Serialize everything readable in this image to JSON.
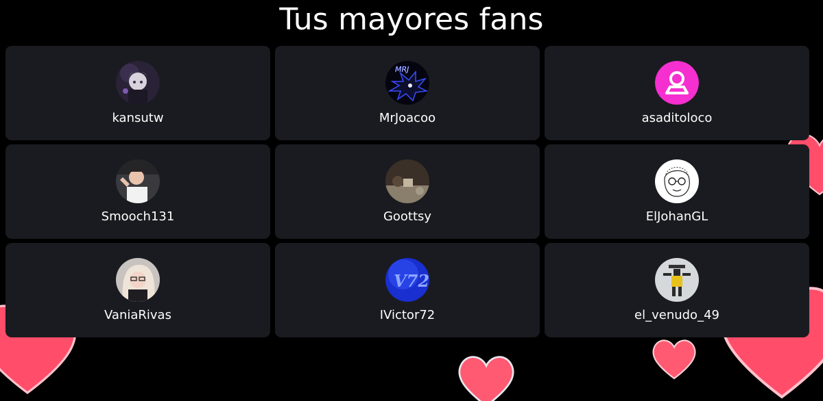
{
  "page": {
    "title": "Tus mayores fans"
  },
  "fans": [
    {
      "username": "kansutw",
      "avatar_icon": "anime-character-avatar-icon"
    },
    {
      "username": "MrJoacoo",
      "avatar_icon": "dark-hedgehog-avatar-icon"
    },
    {
      "username": "asaditoloco",
      "avatar_icon": "default-user-avatar-icon"
    },
    {
      "username": "Smooch131",
      "avatar_icon": "person-photo-avatar-icon"
    },
    {
      "username": "Goottsy",
      "avatar_icon": "scenery-photo-avatar-icon"
    },
    {
      "username": "ElJohanGL",
      "avatar_icon": "sketch-face-avatar-icon"
    },
    {
      "username": "VaniaRivas",
      "avatar_icon": "person-photo-avatar-icon"
    },
    {
      "username": "IVictor72",
      "avatar_icon": "blue-logo-avatar-icon"
    },
    {
      "username": "el_venudo_49",
      "avatar_icon": "pixel-character-avatar-icon"
    }
  ],
  "colors": {
    "background": "#000000",
    "card": "#1a1b20",
    "text": "#ffffff",
    "default_avatar": "#f52fd0",
    "heart": "#ff4d6a"
  }
}
